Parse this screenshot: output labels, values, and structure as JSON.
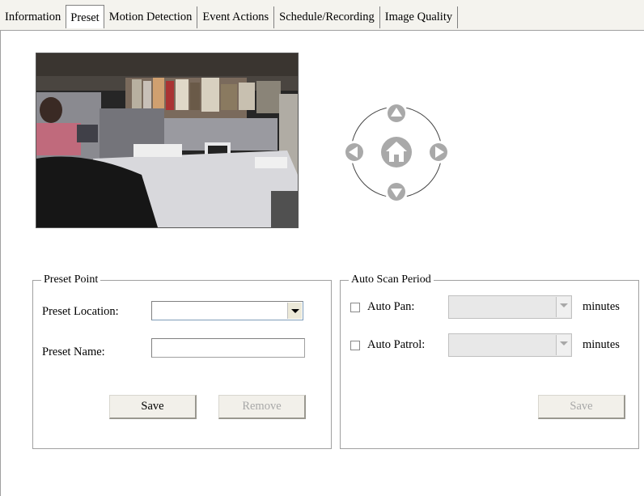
{
  "tabs": [
    {
      "label": "Information"
    },
    {
      "label": "Preset"
    },
    {
      "label": "Motion Detection"
    },
    {
      "label": "Event Actions"
    },
    {
      "label": "Schedule/Recording"
    },
    {
      "label": "Image Quality"
    }
  ],
  "active_tab": "Preset",
  "ptz": {
    "buttons": [
      "up-arrow-icon",
      "left-arrow-icon",
      "home-icon",
      "right-arrow-icon",
      "down-arrow-icon"
    ],
    "button_color": "#a9a9a9"
  },
  "preset_point": {
    "title": "Preset Point",
    "location_label": "Preset Location:",
    "location_value": "",
    "name_label": "Preset Name:",
    "name_value": "",
    "save_label": "Save",
    "remove_label": "Remove"
  },
  "auto_scan": {
    "title": "Auto Scan Period",
    "pan_label": "Auto Pan:",
    "pan_checked": false,
    "pan_unit": "minutes",
    "patrol_label": "Auto Patrol:",
    "patrol_checked": false,
    "patrol_unit": "minutes",
    "save_label": "Save"
  }
}
